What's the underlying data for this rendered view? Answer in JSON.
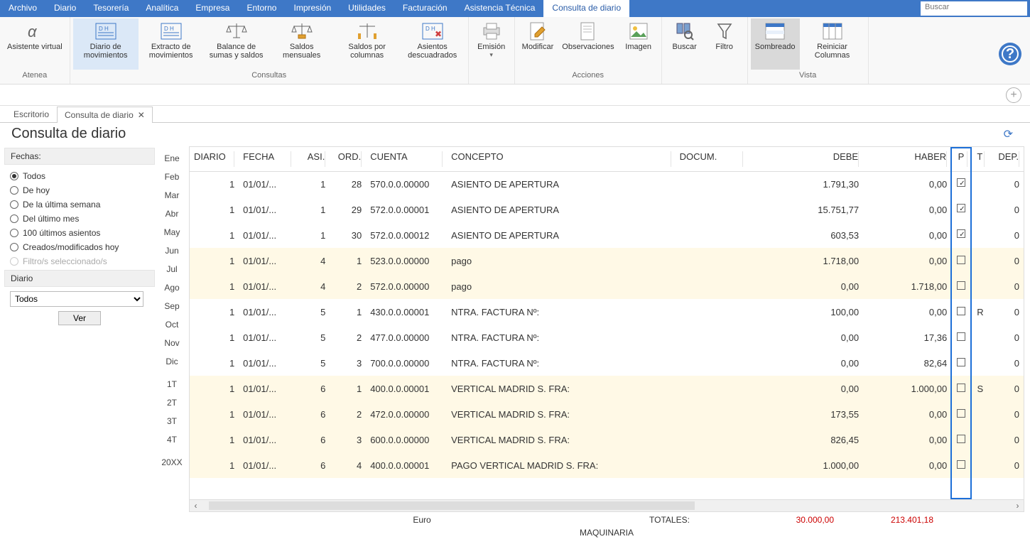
{
  "menubar": {
    "items": [
      "Archivo",
      "Diario",
      "Tesorería",
      "Analítica",
      "Empresa",
      "Entorno",
      "Impresión",
      "Utilidades",
      "Facturación",
      "Asistencia Técnica",
      "Consulta de diario"
    ],
    "active_index": 10,
    "search_placeholder": "Buscar"
  },
  "ribbon": {
    "groups": [
      {
        "label": "Atenea",
        "buttons": [
          {
            "label": "Asistente virtual",
            "id": "asistente"
          }
        ]
      },
      {
        "label": "Consultas",
        "buttons": [
          {
            "label": "Diario de movimientos",
            "id": "diario-mov",
            "active": true
          },
          {
            "label": "Extracto de movimientos",
            "id": "extracto"
          },
          {
            "label": "Balance de sumas y saldos",
            "id": "balance"
          },
          {
            "label": "Saldos mensuales",
            "id": "saldos-mens"
          },
          {
            "label": "Saldos por columnas",
            "id": "saldos-col"
          },
          {
            "label": "Asientos descuadrados",
            "id": "asientos-desc"
          }
        ]
      },
      {
        "label": "",
        "buttons": [
          {
            "label": "Emisión",
            "id": "emision",
            "dropdown": true
          }
        ]
      },
      {
        "label": "Acciones",
        "buttons": [
          {
            "label": "Modificar",
            "id": "modificar"
          },
          {
            "label": "Observaciones",
            "id": "observaciones"
          },
          {
            "label": "Imagen",
            "id": "imagen"
          }
        ]
      },
      {
        "label": "",
        "buttons": [
          {
            "label": "Buscar",
            "id": "ribbon-buscar"
          },
          {
            "label": "Filtro",
            "id": "filtro"
          }
        ]
      },
      {
        "label": "Vista",
        "buttons": [
          {
            "label": "Sombreado",
            "id": "sombreado",
            "shaded": true
          },
          {
            "label": "Reiniciar Columnas",
            "id": "reiniciar"
          }
        ]
      }
    ]
  },
  "tabs": {
    "items": [
      "Escritorio",
      "Consulta de diario"
    ],
    "active_index": 1
  },
  "page_title": "Consulta de diario",
  "sidebar": {
    "fechas_label": "Fechas:",
    "radios": [
      {
        "label": "Todos",
        "checked": true
      },
      {
        "label": "De hoy"
      },
      {
        "label": "De la última semana"
      },
      {
        "label": "Del último mes"
      },
      {
        "label": "100 últimos asientos"
      },
      {
        "label": "Creados/modificados hoy"
      },
      {
        "label": "Filtro/s seleccionado/s",
        "disabled": true
      }
    ],
    "diario_label": "Diario",
    "diario_select": "Todos",
    "ver_label": "Ver"
  },
  "months": [
    "Ene",
    "Feb",
    "Mar",
    "Abr",
    "May",
    "Jun",
    "Jul",
    "Ago",
    "Sep",
    "Oct",
    "Nov",
    "Dic",
    "",
    "1T",
    "2T",
    "3T",
    "4T",
    "",
    "20XX"
  ],
  "grid": {
    "columns": [
      "DIARIO",
      "FECHA",
      "ASI.",
      "ORD.",
      "CUENTA",
      "CONCEPTO",
      "DOCUM.",
      "DEBE",
      "HABER",
      "P",
      "T",
      "DEP."
    ],
    "rows": [
      {
        "diario": "1",
        "fecha": "01/01/...",
        "asi": "1",
        "ord": "28",
        "cuenta": "570.0.0.00000",
        "concepto": "ASIENTO DE APERTURA",
        "docum": "",
        "debe": "1.791,30",
        "haber": "0,00",
        "p": true,
        "t": "",
        "dep": "0",
        "alt": false
      },
      {
        "diario": "1",
        "fecha": "01/01/...",
        "asi": "1",
        "ord": "29",
        "cuenta": "572.0.0.00001",
        "concepto": "ASIENTO DE APERTURA",
        "docum": "",
        "debe": "15.751,77",
        "haber": "0,00",
        "p": true,
        "t": "",
        "dep": "0",
        "alt": false
      },
      {
        "diario": "1",
        "fecha": "01/01/...",
        "asi": "1",
        "ord": "30",
        "cuenta": "572.0.0.00012",
        "concepto": "ASIENTO DE APERTURA",
        "docum": "",
        "debe": "603,53",
        "haber": "0,00",
        "p": true,
        "t": "",
        "dep": "0",
        "alt": false
      },
      {
        "diario": "1",
        "fecha": "01/01/...",
        "asi": "4",
        "ord": "1",
        "cuenta": "523.0.0.00000",
        "concepto": "pago",
        "docum": "",
        "debe": "1.718,00",
        "haber": "0,00",
        "p": false,
        "t": "",
        "dep": "0",
        "alt": true
      },
      {
        "diario": "1",
        "fecha": "01/01/...",
        "asi": "4",
        "ord": "2",
        "cuenta": "572.0.0.00000",
        "concepto": "pago",
        "docum": "",
        "debe": "0,00",
        "haber": "1.718,00",
        "p": false,
        "t": "",
        "dep": "0",
        "alt": true
      },
      {
        "diario": "1",
        "fecha": "01/01/...",
        "asi": "5",
        "ord": "1",
        "cuenta": "430.0.0.00001",
        "concepto": "NTRA. FACTURA Nº:",
        "docum": "",
        "debe": "100,00",
        "haber": "0,00",
        "p": false,
        "t": "R",
        "dep": "0",
        "alt": false
      },
      {
        "diario": "1",
        "fecha": "01/01/...",
        "asi": "5",
        "ord": "2",
        "cuenta": "477.0.0.00000",
        "concepto": "NTRA. FACTURA Nº:",
        "docum": "",
        "debe": "0,00",
        "haber": "17,36",
        "p": false,
        "t": "",
        "dep": "0",
        "alt": false
      },
      {
        "diario": "1",
        "fecha": "01/01/...",
        "asi": "5",
        "ord": "3",
        "cuenta": "700.0.0.00000",
        "concepto": "NTRA. FACTURA Nº:",
        "docum": "",
        "debe": "0,00",
        "haber": "82,64",
        "p": false,
        "t": "",
        "dep": "0",
        "alt": false
      },
      {
        "diario": "1",
        "fecha": "01/01/...",
        "asi": "6",
        "ord": "1",
        "cuenta": "400.0.0.00001",
        "concepto": "VERTICAL MADRID S. FRA:",
        "docum": "",
        "debe": "0,00",
        "haber": "1.000,00",
        "p": false,
        "t": "S",
        "dep": "0",
        "alt": true
      },
      {
        "diario": "1",
        "fecha": "01/01/...",
        "asi": "6",
        "ord": "2",
        "cuenta": "472.0.0.00000",
        "concepto": "VERTICAL MADRID S. FRA:",
        "docum": "",
        "debe": "173,55",
        "haber": "0,00",
        "p": false,
        "t": "",
        "dep": "0",
        "alt": true
      },
      {
        "diario": "1",
        "fecha": "01/01/...",
        "asi": "6",
        "ord": "3",
        "cuenta": "600.0.0.00000",
        "concepto": "VERTICAL MADRID S. FRA:",
        "docum": "",
        "debe": "826,45",
        "haber": "0,00",
        "p": false,
        "t": "",
        "dep": "0",
        "alt": true
      },
      {
        "diario": "1",
        "fecha": "01/01/...",
        "asi": "6",
        "ord": "4",
        "cuenta": "400.0.0.00001",
        "concepto": "PAGO VERTICAL MADRID S. FRA:",
        "docum": "",
        "debe": "1.000,00",
        "haber": "0,00",
        "p": false,
        "t": "",
        "dep": "0",
        "alt": true
      }
    ]
  },
  "footer": {
    "currency": "Euro",
    "label2": "MAQUINARIA",
    "totales_label": "TOTALES:",
    "debe_total": "30.000,00",
    "haber_total": "213.401,18"
  }
}
